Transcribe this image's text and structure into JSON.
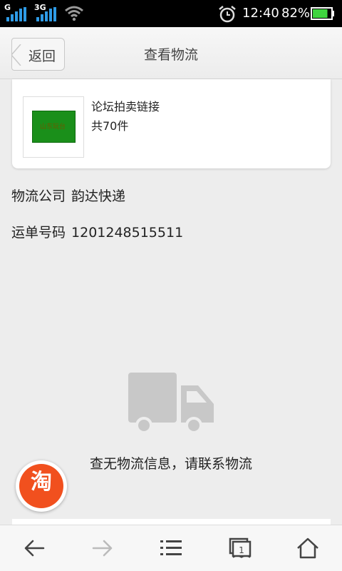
{
  "status_bar": {
    "network1": "G",
    "network2": "3G",
    "time": "12:40",
    "battery_percent": "82%",
    "battery_level": 0.82,
    "icons": [
      "signal-icon",
      "wifi-icon",
      "alarm-icon",
      "battery-icon"
    ]
  },
  "header": {
    "back_label": "返回",
    "title": "查看物流"
  },
  "product": {
    "name": "论坛拍卖链接",
    "count": "共70件",
    "thumbnail_text": "山东玩台"
  },
  "logistics": {
    "company_label": "物流公司",
    "company_value": "韵达快递",
    "tracking_label": "运单号码",
    "tracking_value": "1201248515511"
  },
  "empty_state": {
    "icon": "truck-icon",
    "message": "查无物流信息，请联系物流"
  },
  "taobao_button": {
    "label": "淘"
  },
  "nav": {
    "icons": [
      "back-icon",
      "forward-icon",
      "menu-icon",
      "windows-icon",
      "home-icon"
    ]
  },
  "colors": {
    "accent_orange": "#f1501e",
    "thumbnail_green": "#1a8f1a",
    "battery_green": "#3fd43f"
  }
}
